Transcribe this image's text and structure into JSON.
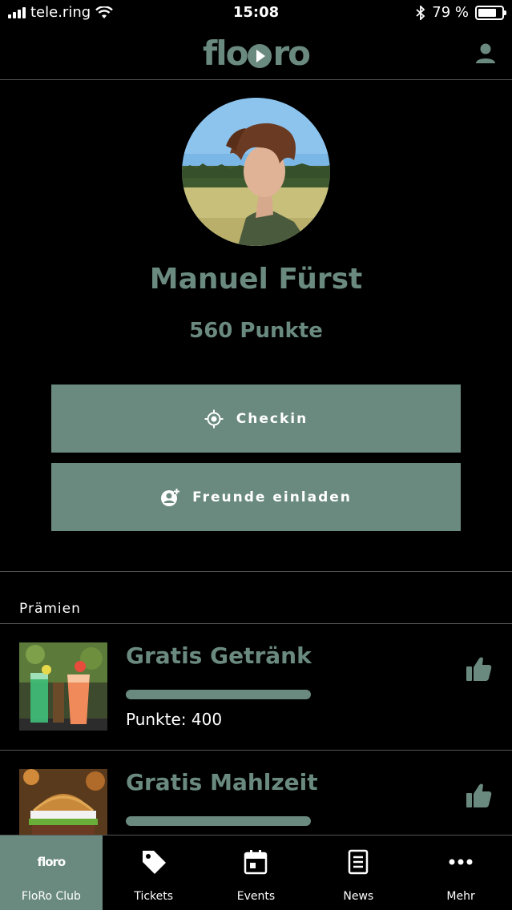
{
  "status_bar": {
    "carrier": "tele.ring",
    "time": "15:08",
    "battery": "79 %",
    "battery_level": 0.79
  },
  "header": {
    "logo_text_left": "flo",
    "logo_text_right": "ro",
    "user_icon": "user-icon"
  },
  "profile": {
    "name": "Manuel Fürst",
    "points": "560 Punkte"
  },
  "actions": {
    "checkin_label": "Checkin",
    "checkin_icon": "target-icon",
    "invite_label": "Freunde einladen",
    "invite_icon": "add-friend-icon"
  },
  "rewards": {
    "section_title": "Prämien",
    "items": [
      {
        "title": "Gratis Getränk",
        "cost": "Punkte: 400",
        "progress": 1.0,
        "icon": "thumbs-up-icon"
      },
      {
        "title": "Gratis Mahlzeit",
        "cost": "",
        "progress": 1.0,
        "icon": "thumbs-up-icon"
      }
    ]
  },
  "tabbar": {
    "tabs": [
      {
        "label": "FloRo Club",
        "icon": "floro-logo",
        "active": true
      },
      {
        "label": "Tickets",
        "icon": "tag-icon",
        "active": false
      },
      {
        "label": "Events",
        "icon": "calendar-icon",
        "active": false
      },
      {
        "label": "News",
        "icon": "document-icon",
        "active": false
      },
      {
        "label": "Mehr",
        "icon": "more-icon",
        "active": false
      }
    ],
    "logo_text": "floro"
  },
  "colors": {
    "accent": "#6a8a80",
    "background": "#000000",
    "divider": "#555555"
  }
}
